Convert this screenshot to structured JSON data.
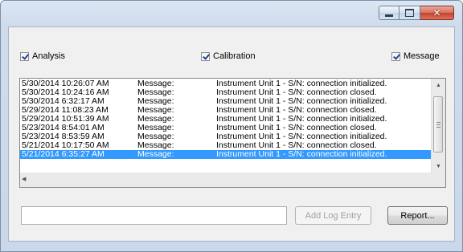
{
  "filters": {
    "analysis": {
      "label": "Analysis",
      "checked": true
    },
    "calibration": {
      "label": "Calibration",
      "checked": true
    },
    "message": {
      "label": "Message",
      "checked": true
    }
  },
  "log": {
    "rows": [
      {
        "time": "5/30/2014 10:26:07 AM",
        "type": "Message:",
        "text": "Instrument Unit 1 - S/N:  connection initialized."
      },
      {
        "time": "5/30/2014 10:24:16 AM",
        "type": "Message:",
        "text": "Instrument Unit 1 - S/N:  connection closed."
      },
      {
        "time": "5/30/2014 6:32:17 AM",
        "type": "Message:",
        "text": "Instrument Unit 1 - S/N:  connection initialized."
      },
      {
        "time": "5/29/2014 11:08:23 AM",
        "type": "Message:",
        "text": "Instrument Unit 1 - S/N:  connection closed."
      },
      {
        "time": "5/29/2014 10:51:39 AM",
        "type": "Message:",
        "text": "Instrument Unit 1 - S/N:  connection initialized."
      },
      {
        "time": "5/23/2014 8:54:01 AM",
        "type": "Message:",
        "text": "Instrument Unit 1 - S/N:  connection closed."
      },
      {
        "time": "5/23/2014 8:53:59 AM",
        "type": "Message:",
        "text": "Instrument Unit 1 - S/N:  connection initialized."
      },
      {
        "time": "5/21/2014 10:17:50 AM",
        "type": "Message:",
        "text": "Instrument Unit 1 - S/N:  connection closed."
      },
      {
        "time": "5/21/2014 6:35:27 AM",
        "type": "Message:",
        "text": "Instrument Unit 1 - S/N:  connection initialized."
      }
    ],
    "selected_index": 8
  },
  "entry": {
    "value": ""
  },
  "buttons": {
    "add_log_entry": "Add Log Entry",
    "report": "Report..."
  },
  "caption": {
    "close_glyph": "✕"
  },
  "icons": {
    "minimize": "minimize-icon",
    "maximize": "maximize-icon",
    "close": "close-icon"
  },
  "colors": {
    "selection": "#3399ff",
    "close_button": "#c4412b",
    "window_frame": "#cfdcec"
  }
}
